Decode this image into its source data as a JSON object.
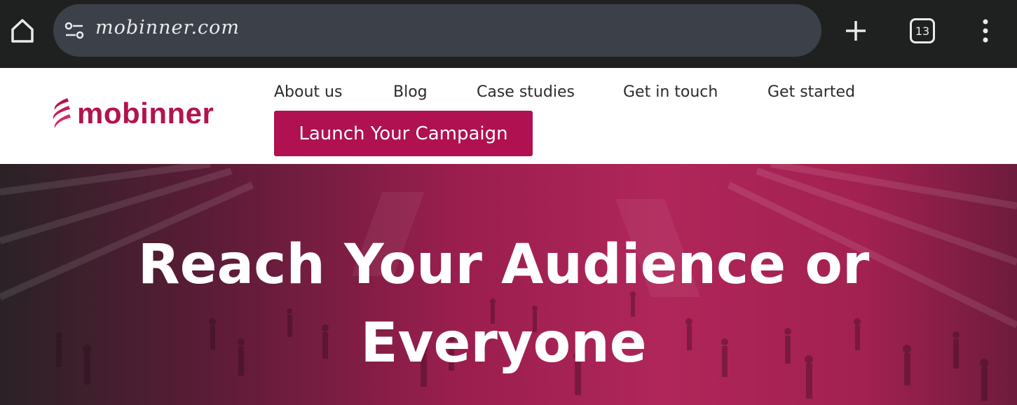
{
  "browser": {
    "url": "mobinner.com",
    "tab_count": "13",
    "icons": {
      "home": "home-icon",
      "site_info": "tune-icon",
      "new_tab": "plus-icon",
      "tabs": "tab-switcher-icon",
      "menu": "more-vert-icon"
    }
  },
  "site": {
    "brand": "mobinner",
    "brand_color": "#b3134f",
    "nav": {
      "items": [
        "About us",
        "Blog",
        "Case studies",
        "Get in touch",
        "Get started"
      ],
      "cta_label": "Launch Your Campaign"
    },
    "hero": {
      "title_line1": "Reach Your Audience or",
      "title_line2": "Everyone"
    }
  }
}
